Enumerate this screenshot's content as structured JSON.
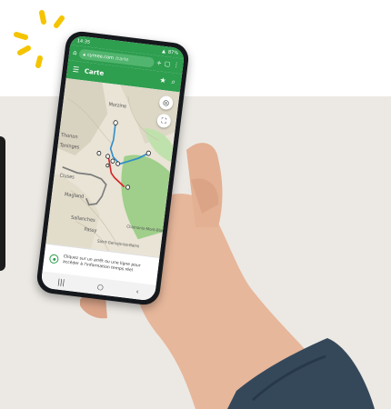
{
  "status_bar": {
    "time": "14:35",
    "battery": "87%"
  },
  "browser": {
    "url_host": "cymee.com",
    "url_path": "/carte",
    "icons": [
      "home-icon",
      "lock-icon",
      "plus-icon",
      "tabs-icon",
      "more-vertical-icon"
    ]
  },
  "app_bar": {
    "title": "Carte",
    "icons": [
      "menu-icon",
      "star-icon",
      "search-icon"
    ]
  },
  "map": {
    "place_labels": [
      "Morzine",
      "Thonon",
      "Taninges",
      "Cluses",
      "Magland",
      "Sallanches",
      "Passy",
      "Saint-Gervais-les-Bains",
      "Chamonix-Mont-Blanc"
    ],
    "colors": {
      "route_blue": "#2f8ec9",
      "route_red": "#d9242a",
      "route_gray": "#7c7c7c",
      "forest": "#9fcf8a"
    }
  },
  "controls": {
    "locate_icon": "crosshair-icon",
    "focus_icon": "focus-icon"
  },
  "info_panel": {
    "text": "Cliquez sur un arrêt ou une ligne pour accéder à l'information temps réel"
  },
  "nav": {
    "icons": [
      "recent-apps-icon",
      "home-circle-icon",
      "back-chevron-icon"
    ]
  },
  "colors": {
    "brand_green": "#2e9e4f",
    "burst_yellow": "#f5c400",
    "background": "#ece9e4"
  }
}
